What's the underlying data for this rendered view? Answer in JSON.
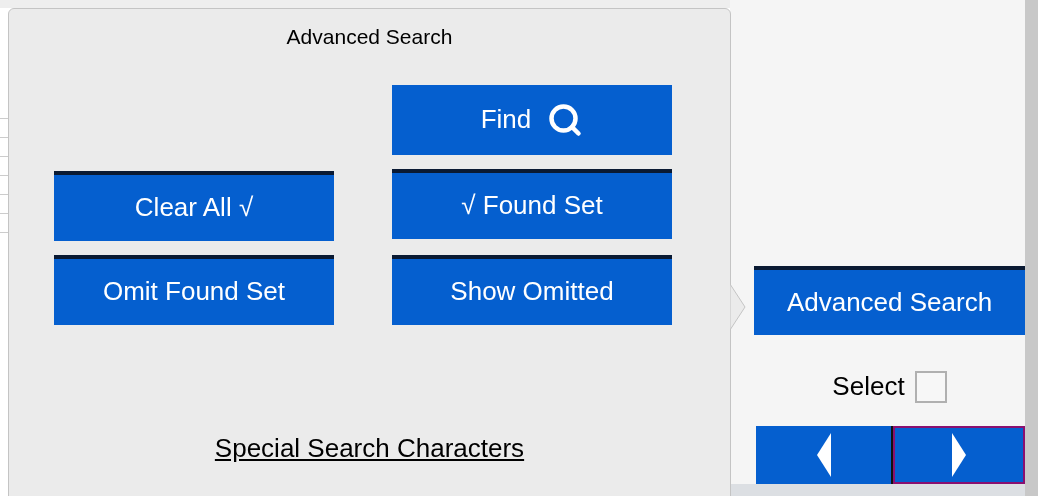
{
  "popover": {
    "title": "Advanced Search",
    "buttons": [
      {
        "label": "Find",
        "kind": "find",
        "top_rule": false
      },
      {
        "label": "Clear All  √",
        "kind": "action",
        "top_rule": true
      },
      {
        "label": "√  Found Set",
        "kind": "action",
        "top_rule": true
      },
      {
        "label": "Omit Found Set",
        "kind": "action",
        "top_rule": true
      },
      {
        "label": "Show Omitted",
        "kind": "action",
        "top_rule": true
      }
    ],
    "link": "Special Search Characters"
  },
  "side_panel": {
    "button": "Advanced Search",
    "select": {
      "label": "Select",
      "checked": false
    },
    "nav": [
      {
        "kind": "previous",
        "focused": false
      },
      {
        "kind": "next",
        "focused": true
      }
    ]
  }
}
